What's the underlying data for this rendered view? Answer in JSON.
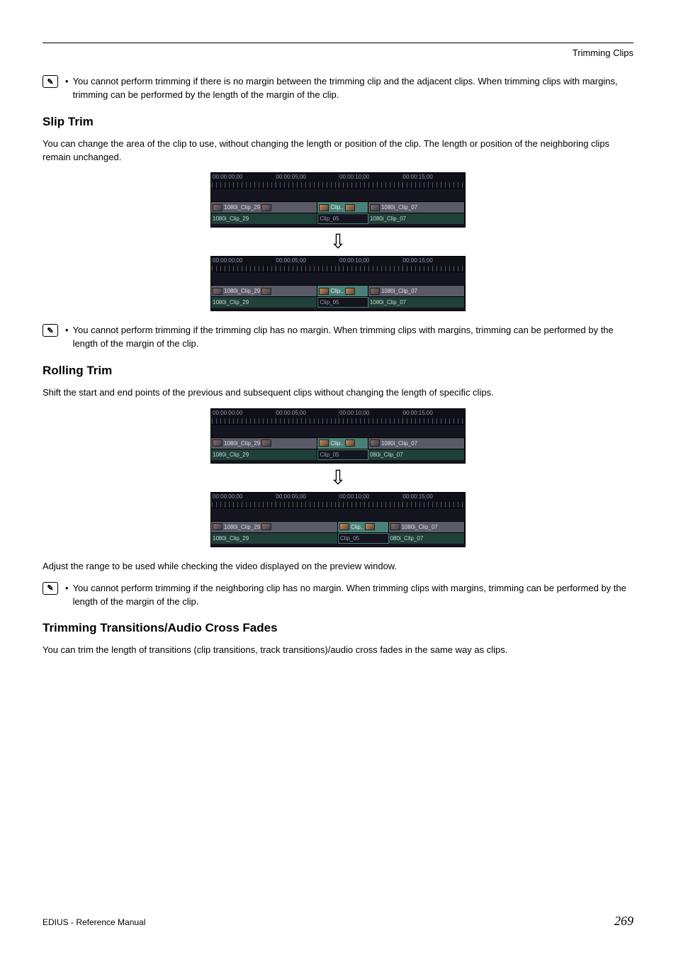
{
  "header": {
    "right": "Trimming Clips"
  },
  "note1": {
    "text": "You cannot perform trimming if there is no margin between the trimming clip and the adjacent clips. When trimming clips with margins, trimming can be performed by the length of the margin of the clip."
  },
  "slip": {
    "heading": "Slip Trim",
    "body": "You can change the area of the clip to use, without changing the length or position of the clip. The length or position of the neighboring clips remain unchanged.",
    "note": "You cannot perform trimming if the trimming clip has no margin. When trimming clips with margins, trimming can be performed by the length of the margin of the clip."
  },
  "rolling": {
    "heading": "Rolling Trim",
    "body": "Shift the start and end points of the previous and subsequent clips without changing the length of specific clips.",
    "adjust": "Adjust the range to be used while checking the video displayed on the preview window.",
    "note": "You cannot perform trimming if the neighboring clip has no margin. When trimming clips with margins, trimming can be performed by the length of the margin of the clip."
  },
  "trans": {
    "heading": "Trimming Transitions/Audio Cross Fades",
    "body": "You can trim the length of transitions (clip transitions, track transitions)/audio cross fades in the same way as clips."
  },
  "timeline": {
    "marks": [
      "00:00:00;00",
      "00:00:05;00",
      "00:00:10;00",
      "00:00:15;00"
    ],
    "clip29": "1080i_Clip_29",
    "clip05v": "Clip..",
    "clip05a": "Clip_05",
    "clip07": "1080i_Clip_07",
    "clip07short": "080i_Clip_07"
  },
  "footer": {
    "left": "EDIUS - Reference Manual",
    "page": "269"
  }
}
